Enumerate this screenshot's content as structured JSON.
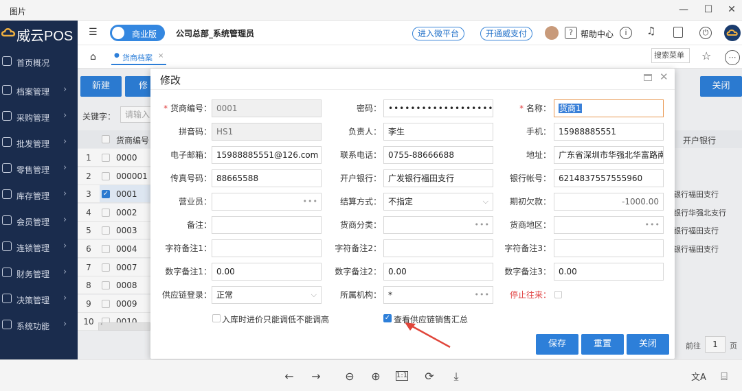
{
  "window": {
    "title": "图片"
  },
  "sidebar": {
    "logo": "威云POS",
    "items": [
      {
        "label": "首页概况",
        "has_arrow": false
      },
      {
        "label": "档案管理",
        "has_arrow": true
      },
      {
        "label": "采购管理",
        "has_arrow": true
      },
      {
        "label": "批发管理",
        "has_arrow": true
      },
      {
        "label": "零售管理",
        "has_arrow": true
      },
      {
        "label": "库存管理",
        "has_arrow": true
      },
      {
        "label": "会员管理",
        "has_arrow": true
      },
      {
        "label": "连锁管理",
        "has_arrow": true
      },
      {
        "label": "财务管理",
        "has_arrow": true
      },
      {
        "label": "决策管理",
        "has_arrow": true
      },
      {
        "label": "系统功能",
        "has_arrow": true
      }
    ]
  },
  "header": {
    "edition_badge": "商业版",
    "org": "公司总部_系统管理员",
    "link1": "进入微平台",
    "link2": "开通威支付",
    "help": "帮助中心"
  },
  "tabs": {
    "active": "货商档案",
    "search_menu": "搜索菜单"
  },
  "background": {
    "new_btn": "新建",
    "edit_btn": "修改",
    "close_btn": "关闭",
    "keyword_label": "关键字：",
    "keyword_placeholder": "请输入",
    "col_code": "货商编号",
    "col_bank": "开户银行",
    "rows": [
      {
        "n": "1",
        "code": "0000",
        "checked": false,
        "bank": ""
      },
      {
        "n": "2",
        "code": "000001",
        "checked": false,
        "bank": ""
      },
      {
        "n": "3",
        "code": "0001",
        "checked": true,
        "bank": "银行福田支行"
      },
      {
        "n": "4",
        "code": "0002",
        "checked": false,
        "bank": "银行华强北支行"
      },
      {
        "n": "5",
        "code": "0003",
        "checked": false,
        "bank": "银行福田支行"
      },
      {
        "n": "6",
        "code": "0004",
        "checked": false,
        "bank": "银行福田支行"
      },
      {
        "n": "7",
        "code": "0007",
        "checked": false,
        "bank": ""
      },
      {
        "n": "8",
        "code": "0008",
        "checked": false,
        "bank": ""
      },
      {
        "n": "9",
        "code": "0009",
        "checked": false,
        "bank": ""
      },
      {
        "n": "10",
        "code": "0010",
        "checked": false,
        "bank": ""
      }
    ],
    "pager_label": "前往",
    "pager_value": "1",
    "pager_unit": "页"
  },
  "modal": {
    "title": "修改",
    "fields": {
      "code": {
        "label": "货商编号：",
        "value": "0001"
      },
      "password": {
        "label": "密码：",
        "value": "••••••••••••••••••••••••"
      },
      "name": {
        "label": "名称：",
        "value": "货商1"
      },
      "pinyin": {
        "label": "拼音码：",
        "value": "HS1"
      },
      "owner": {
        "label": "负责人：",
        "value": "李生"
      },
      "mobile": {
        "label": "手机：",
        "value": "15988885551"
      },
      "email": {
        "label": "电子邮箱：",
        "value": "15988885551@126.com"
      },
      "phone": {
        "label": "联系电话：",
        "value": "0755-88666688"
      },
      "address": {
        "label": "地址：",
        "value": "广东省深圳市华强北华富路南"
      },
      "fax": {
        "label": "传真号码：",
        "value": "88665588"
      },
      "bank": {
        "label": "开户银行：",
        "value": "广发银行福田支行"
      },
      "account": {
        "label": "银行帐号：",
        "value": "6214837557555960"
      },
      "salesman": {
        "label": "营业员：",
        "value": ""
      },
      "settle": {
        "label": "结算方式：",
        "value": "不指定"
      },
      "opening": {
        "label": "期初欠款：",
        "value": "-1000.00"
      },
      "remark": {
        "label": "备注：",
        "value": ""
      },
      "category": {
        "label": "货商分类：",
        "value": ""
      },
      "region": {
        "label": "货商地区：",
        "value": ""
      },
      "str1": {
        "label": "字符备注1：",
        "value": ""
      },
      "str2": {
        "label": "字符备注2：",
        "value": ""
      },
      "str3": {
        "label": "字符备注3：",
        "value": ""
      },
      "num1": {
        "label": "数字备注1：",
        "value": "0.00"
      },
      "num2": {
        "label": "数字备注2：",
        "value": "0.00"
      },
      "num3": {
        "label": "数字备注3：",
        "value": "0.00"
      },
      "supply_login": {
        "label": "供应链登录：",
        "value": "正常"
      },
      "org": {
        "label": "所属机构：",
        "value": "*"
      },
      "stop": {
        "label": "停止往来："
      }
    },
    "check_price": {
      "label": "入库时进价只能调低不能调高",
      "checked": false
    },
    "check_supply": {
      "label": "查看供应链销售汇总",
      "checked": true
    },
    "btn_save": "保存",
    "btn_reset": "重置",
    "btn_close": "关闭"
  },
  "colors": {
    "primary": "#2d7fd9",
    "sidebar": "#1a2c4d",
    "required": "#e04040",
    "arrow": "#e0453a"
  }
}
